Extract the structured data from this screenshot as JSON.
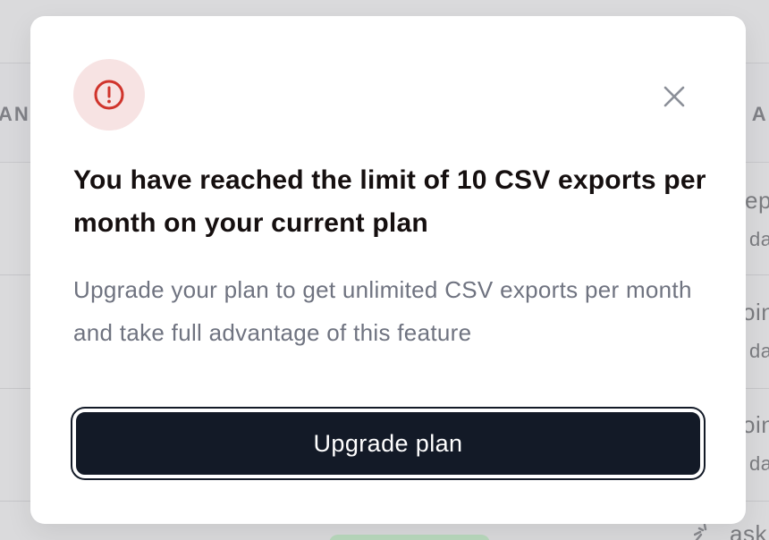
{
  "background_table": {
    "header_left": "ANI",
    "header_right": "T A",
    "rows": [
      {
        "line1": "ep",
        "line2": "da"
      },
      {
        "line1": "oin",
        "line2": "da"
      },
      {
        "line1": "oin",
        "line2": "da"
      }
    ],
    "last_row_text": "ask"
  },
  "modal": {
    "title": "You have reached the limit of 10 CSV exports per month on your current plan",
    "description": "Upgrade your plan to get unlimited CSV exports per month and take full advantage of this feature",
    "primary_button_label": "Upgrade plan",
    "alert_icon": "alert-circle-icon",
    "close_icon": "close-icon",
    "colors": {
      "button_bg": "#131a27",
      "alert_bg": "#f7e3e3",
      "alert_fg": "#d0342c"
    }
  }
}
